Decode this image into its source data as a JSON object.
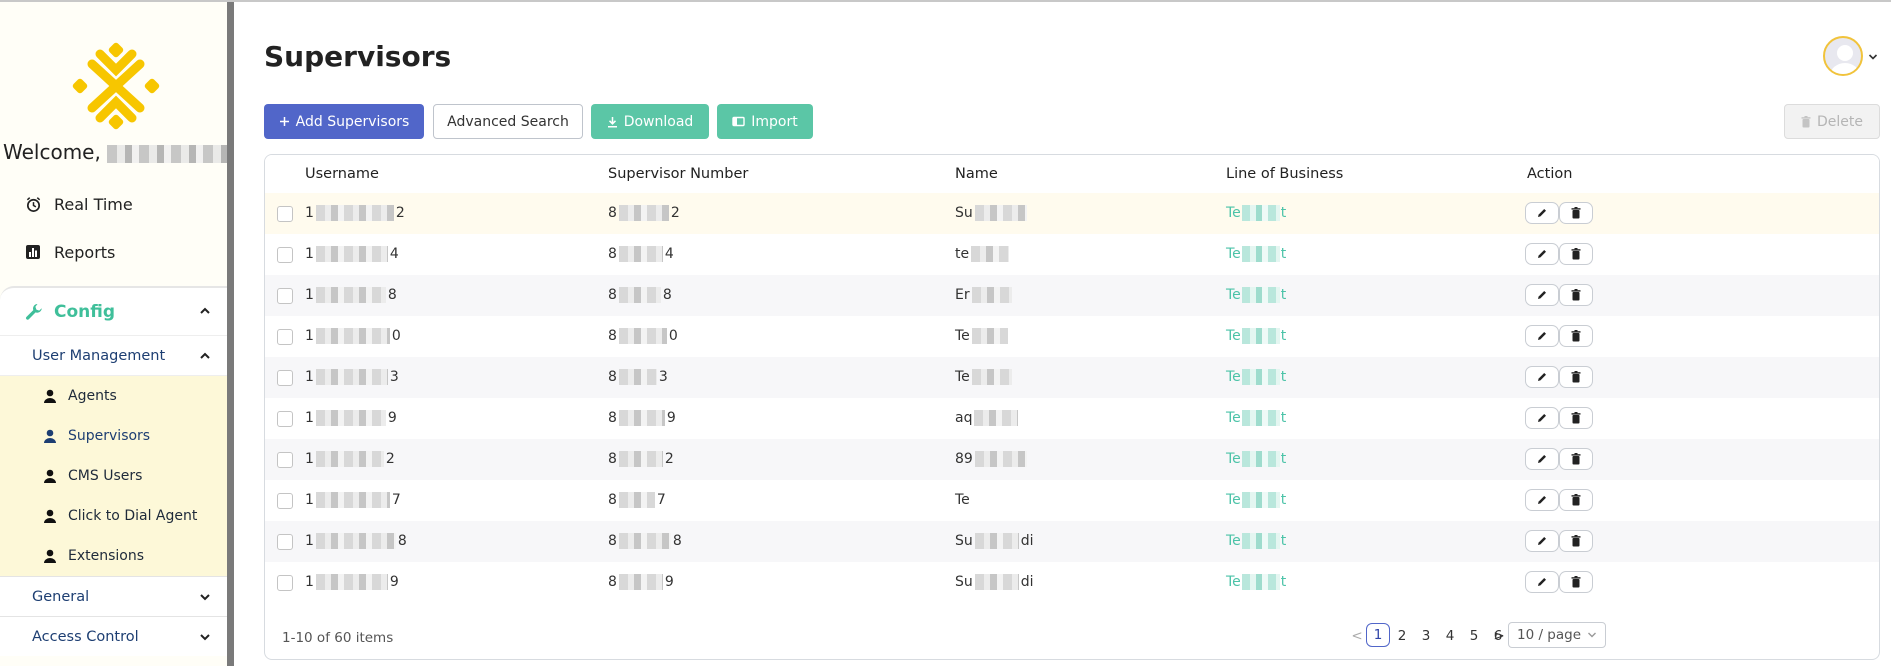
{
  "sidebar": {
    "welcome": "Welcome,",
    "nav": [
      {
        "label": "Real Time",
        "icon": "alarm-clock-icon"
      },
      {
        "label": "Reports",
        "icon": "bar-chart-icon"
      }
    ],
    "config": {
      "label": "Config",
      "icon": "wrench-icon"
    },
    "user_management": {
      "label": "User Management"
    },
    "sub_items": [
      {
        "label": "Agents"
      },
      {
        "label": "Supervisors"
      },
      {
        "label": "CMS Users"
      },
      {
        "label": "Click to Dial Agent"
      },
      {
        "label": "Extensions"
      }
    ],
    "groups": [
      {
        "label": "General"
      },
      {
        "label": "Access Control"
      }
    ]
  },
  "header": {
    "title": "Supervisors"
  },
  "toolbar": {
    "add_label": "Add Supervisors",
    "advanced_search_label": "Advanced Search",
    "download_label": "Download",
    "import_label": "Import",
    "delete_label": "Delete"
  },
  "table": {
    "columns": [
      "Username",
      "Supervisor Number",
      "Name",
      "Line of Business",
      "Action"
    ],
    "rows": [
      {
        "username_start": "1",
        "username_end": "2",
        "number_start": "8",
        "number_end": "2",
        "name_start": "Su",
        "name_end": "",
        "lob_start": "Te",
        "lob_end": "t"
      },
      {
        "username_start": "1",
        "username_end": "4",
        "number_start": "8",
        "number_end": "4",
        "name_start": "te",
        "name_end": "",
        "lob_start": "Te",
        "lob_end": "t"
      },
      {
        "username_start": "1",
        "username_end": "8",
        "number_start": "8",
        "number_end": "8",
        "name_start": "Er",
        "name_end": "",
        "lob_start": "Te",
        "lob_end": "t"
      },
      {
        "username_start": "1",
        "username_end": "0",
        "number_start": "8",
        "number_end": "0",
        "name_start": "Te",
        "name_end": "",
        "lob_start": "Te",
        "lob_end": "t"
      },
      {
        "username_start": "1",
        "username_end": "3",
        "number_start": "8",
        "number_end": "3",
        "name_start": "Te",
        "name_end": "",
        "lob_start": "Te",
        "lob_end": "t"
      },
      {
        "username_start": "1",
        "username_end": "9",
        "number_start": "8",
        "number_end": "9",
        "name_start": "aq",
        "name_end": "",
        "lob_start": "Te",
        "lob_end": "t"
      },
      {
        "username_start": "1",
        "username_end": "2",
        "number_start": "8",
        "number_end": "2",
        "name_start": "89",
        "name_end": "",
        "lob_start": "Te",
        "lob_end": "t"
      },
      {
        "username_start": "1",
        "username_end": "7",
        "number_start": "8",
        "number_end": "7",
        "name_start": "Te",
        "name_end": "",
        "lob_start": "Te",
        "lob_end": "t"
      },
      {
        "username_start": "1",
        "username_end": "8",
        "number_start": "8",
        "number_end": "8",
        "name_start": "Su",
        "name_end": "di",
        "lob_start": "Te",
        "lob_end": "t"
      },
      {
        "username_start": "1",
        "username_end": "9",
        "number_start": "8",
        "number_end": "9",
        "name_start": "Su",
        "name_end": "di",
        "lob_start": "Te",
        "lob_end": "t"
      }
    ]
  },
  "pagination": {
    "summary": "1-10 of 60 items",
    "prev": "<",
    "next": ">",
    "pages": [
      "1",
      "2",
      "3",
      "4",
      "5",
      "6"
    ],
    "current": "1",
    "page_size": "10 / page"
  },
  "colors": {
    "primary": "#5166c9",
    "accent_green": "#5bc6a6",
    "logo_yellow": "#f7c600",
    "sidebar_sub_bg": "#fdf8d8"
  }
}
